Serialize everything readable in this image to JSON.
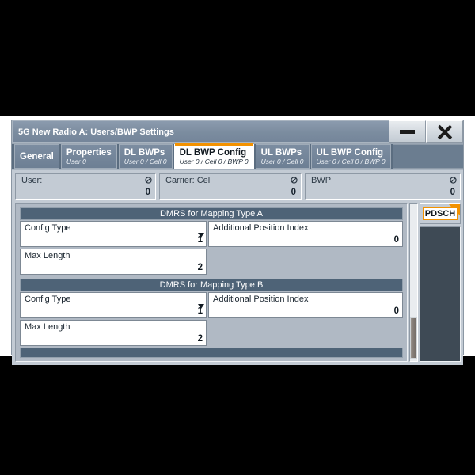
{
  "window": {
    "title": "5G New Radio A: Users/BWP Settings",
    "minimize_label": "minimize",
    "close_label": "close"
  },
  "tabs": [
    {
      "label": "General",
      "sub": ""
    },
    {
      "label": "Properties",
      "sub": "User 0"
    },
    {
      "label": "DL BWPs",
      "sub": "User 0 / Cell 0"
    },
    {
      "label": "DL BWP Config",
      "sub": "User 0 / Cell 0 / BWP 0"
    },
    {
      "label": "UL BWPs",
      "sub": "User 0 / Cell 0"
    },
    {
      "label": "UL BWP Config",
      "sub": "User 0 / Cell 0 / BWP 0"
    }
  ],
  "active_tab_index": 3,
  "selectors": [
    {
      "label": "User:",
      "value": "0"
    },
    {
      "label": "Carrier: Cell",
      "value": "0"
    },
    {
      "label": "BWP",
      "value": "0"
    }
  ],
  "groups": [
    {
      "header": "DMRS for Mapping Type A",
      "rows": [
        [
          {
            "label": "Config Type",
            "value": "1",
            "dropdown": true
          },
          {
            "label": "Additional Position Index",
            "value": "0",
            "dropdown": false
          }
        ],
        [
          {
            "label": "Max Length",
            "value": "2",
            "dropdown": false
          },
          {
            "empty": true
          }
        ]
      ]
    },
    {
      "header": "DMRS for Mapping Type B",
      "rows": [
        [
          {
            "label": "Config Type",
            "value": "1",
            "dropdown": true
          },
          {
            "label": "Additional Position Index",
            "value": "0",
            "dropdown": false
          }
        ],
        [
          {
            "label": "Max Length",
            "value": "2",
            "dropdown": false
          },
          {
            "empty": true
          }
        ]
      ]
    }
  ],
  "side_tab": {
    "label": "PDSCH"
  },
  "colors": {
    "accent_orange": "#f39200",
    "title_blue": "#7b8c9f",
    "group_header": "#4e6377",
    "panel_bg": "#b0b9c4",
    "window_bg": "#c3cbd4",
    "side_panel": "#3e4a55"
  }
}
